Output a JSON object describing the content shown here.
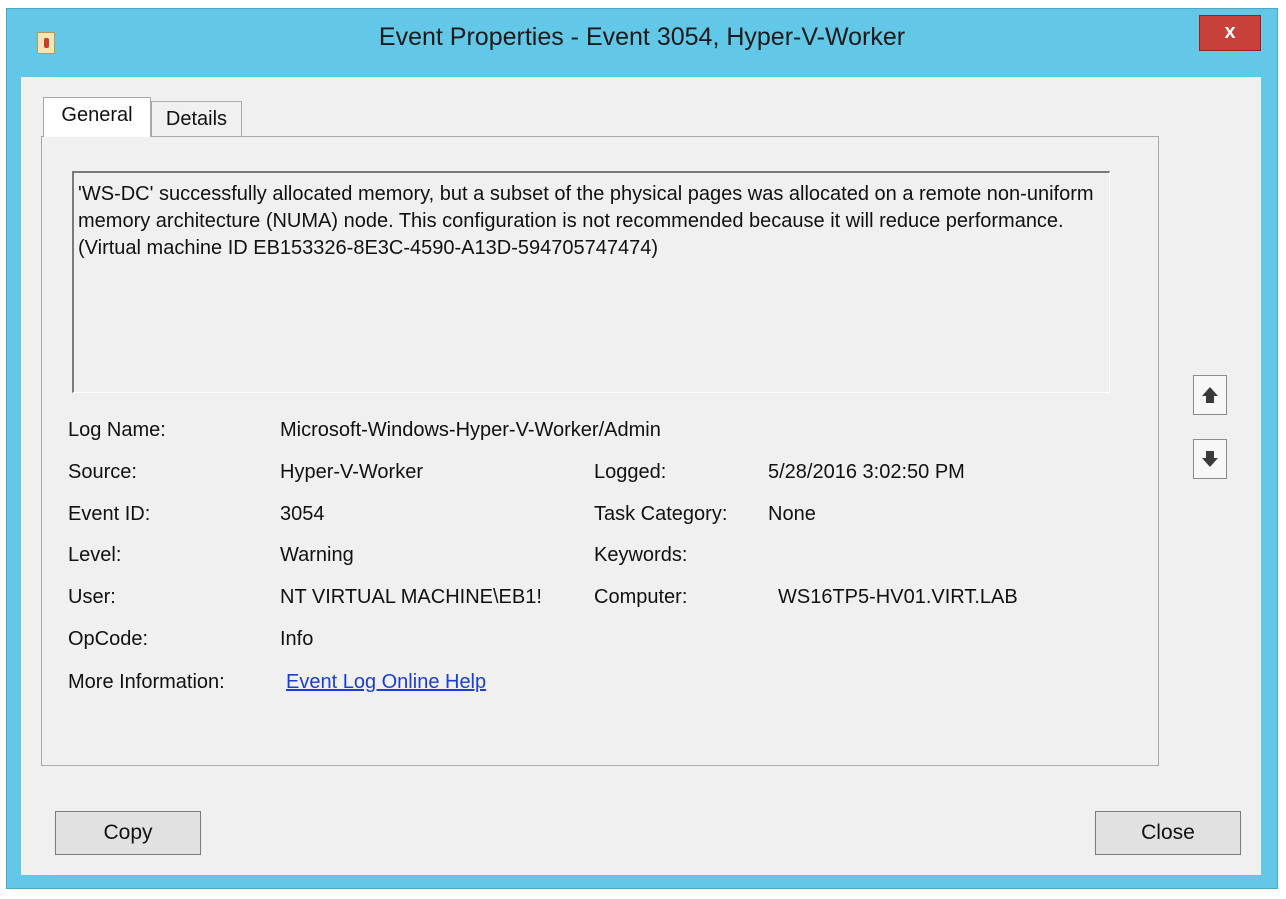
{
  "window": {
    "title": "Event Properties - Event 3054, Hyper-V-Worker",
    "close_glyph": "x"
  },
  "tabs": [
    {
      "label": "General"
    },
    {
      "label": "Details"
    }
  ],
  "description": "'WS-DC' successfully allocated memory, but a subset of the physical pages was allocated on a remote non-uniform memory architecture (NUMA) node. This configuration is not recommended because it will reduce performance. (Virtual machine ID EB153326-8E3C-4590-A13D-594705747474)",
  "fields": {
    "log_name": {
      "label": "Log Name:",
      "value": "Microsoft-Windows-Hyper-V-Worker/Admin"
    },
    "source": {
      "label": "Source:",
      "value": "Hyper-V-Worker"
    },
    "logged": {
      "label": "Logged:",
      "value": "5/28/2016 3:02:50 PM"
    },
    "event_id": {
      "label": "Event ID:",
      "value": "3054"
    },
    "task_category": {
      "label": "Task Category:",
      "value": "None"
    },
    "level": {
      "label": "Level:",
      "value": "Warning"
    },
    "keywords": {
      "label": "Keywords:",
      "value": ""
    },
    "user": {
      "label": "User:",
      "value": "NT VIRTUAL MACHINE\\EB1!"
    },
    "computer": {
      "label": "Computer:",
      "value": "WS16TP5-HV01.VIRT.LAB"
    },
    "opcode": {
      "label": "OpCode:",
      "value": "Info"
    },
    "more_info": {
      "label": "More Information:",
      "link": "Event Log Online Help"
    }
  },
  "buttons": {
    "copy": "Copy",
    "close": "Close"
  },
  "icons": {
    "app": "event-viewer-icon",
    "up": "arrow-up-icon",
    "down": "arrow-down-icon"
  },
  "colors": {
    "titlebar": "#63c8e8",
    "close": "#c7413a",
    "link": "#1a3fcf"
  }
}
